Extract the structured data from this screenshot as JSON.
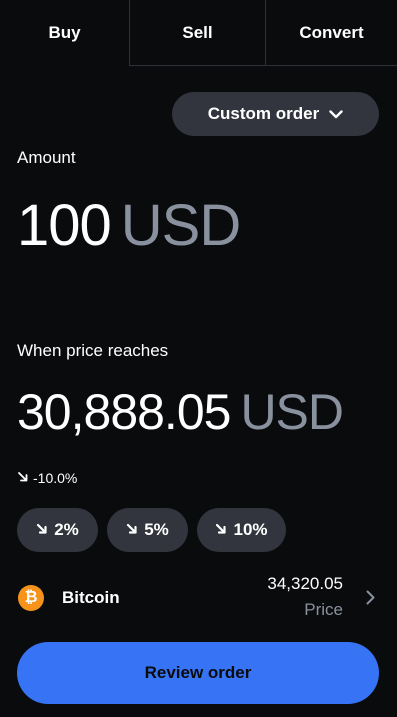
{
  "tabs": [
    {
      "label": "Buy"
    },
    {
      "label": "Sell"
    },
    {
      "label": "Convert"
    }
  ],
  "order_type": {
    "label": "Custom order",
    "icon": "chevron-down-icon"
  },
  "amount": {
    "label": "Amount",
    "value": "100",
    "currency": "USD"
  },
  "limit_price": {
    "label": "When price reaches",
    "value": "30,888.05",
    "currency": "USD",
    "change": "-10.0%"
  },
  "presets": [
    {
      "label": "2%",
      "icon": "arrow-down-right-icon"
    },
    {
      "label": "5%",
      "icon": "arrow-down-right-icon"
    },
    {
      "label": "10%",
      "icon": "arrow-down-right-icon"
    }
  ],
  "asset": {
    "name": "Bitcoin",
    "icon_glyph": "₿",
    "price": "34,320.05",
    "price_label": "Price"
  },
  "review": {
    "label": "Review order"
  },
  "colors": {
    "background": "#0a0b0d",
    "surface": "#32353d",
    "accent": "#3773f5",
    "muted": "#8a919e",
    "bitcoin": "#f7931a"
  }
}
